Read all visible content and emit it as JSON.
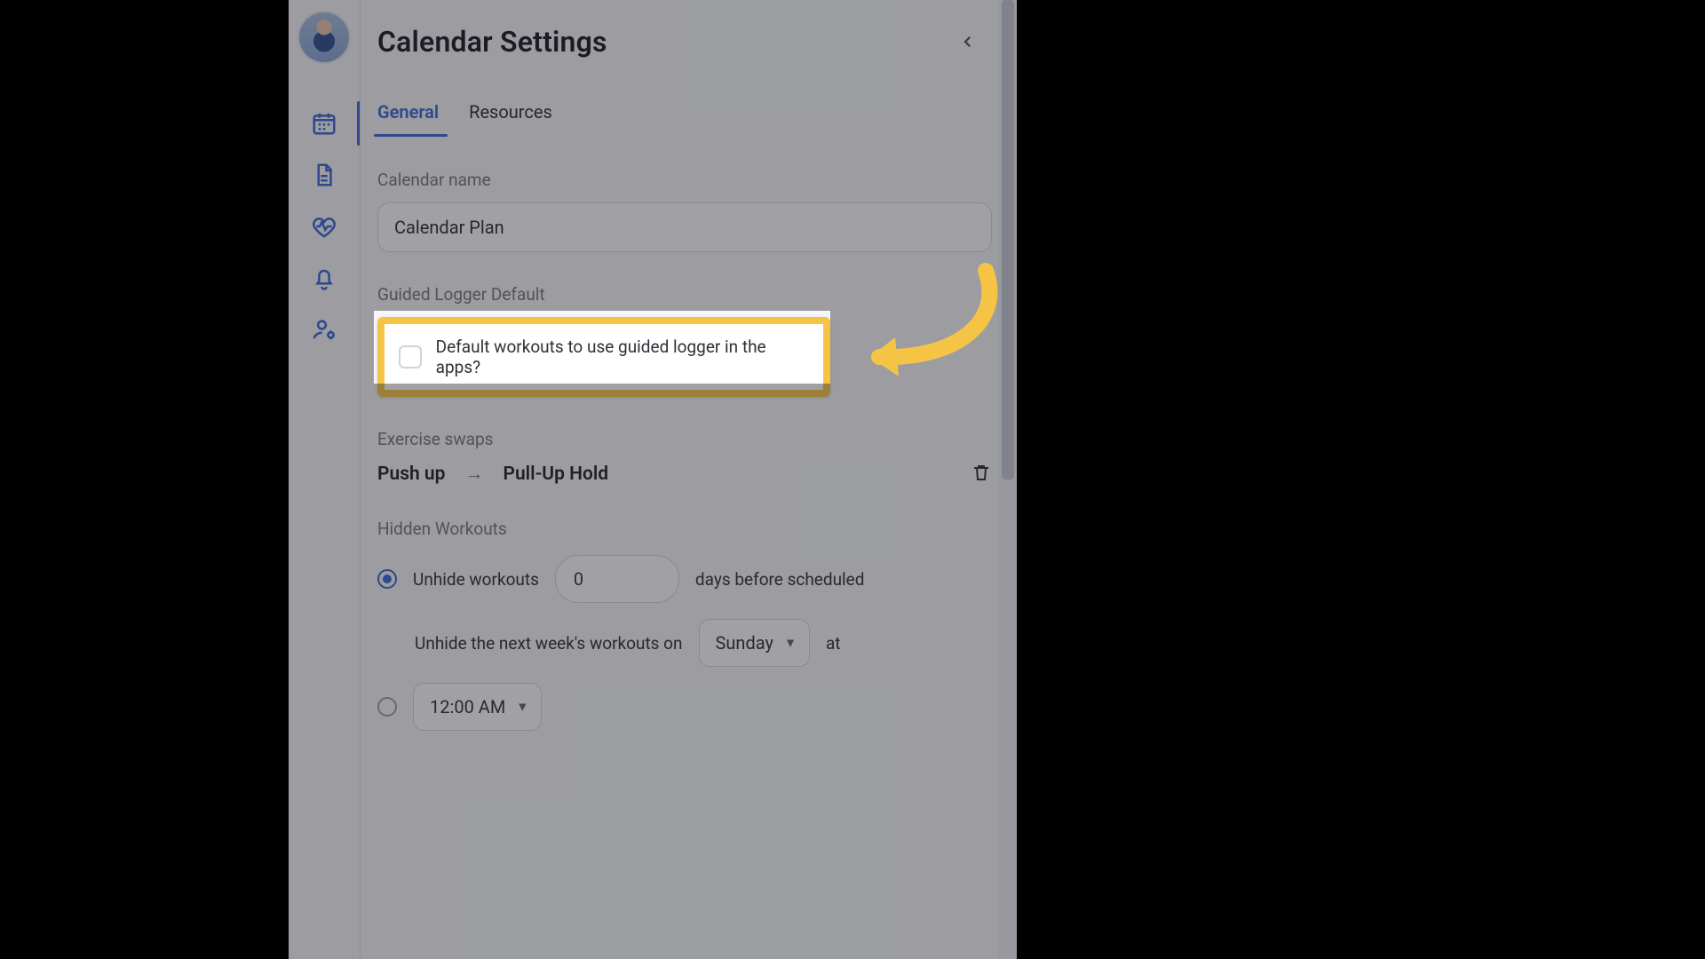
{
  "header": {
    "title": "Calendar Settings"
  },
  "tabs": {
    "general": "General",
    "resources": "Resources"
  },
  "labels": {
    "calendar_name": "Calendar name",
    "guided_default": "Guided Logger Default",
    "exercise_swaps": "Exercise swaps",
    "hidden_workouts": "Hidden Workouts"
  },
  "calendar": {
    "name_value": "Calendar Plan"
  },
  "guided": {
    "checkbox_label": "Default workouts to use guided logger in the apps?"
  },
  "swap": {
    "from": "Push up",
    "to": "Pull-Up Hold"
  },
  "hidden": {
    "opt1_prefix": "Unhide workouts",
    "opt1_suffix": "days before scheduled",
    "days_value": "0",
    "opt2_prefix": "Unhide the next week's workouts on",
    "opt2_middle": "at",
    "day_value": "Sunday",
    "time_value": "12:00 AM"
  }
}
